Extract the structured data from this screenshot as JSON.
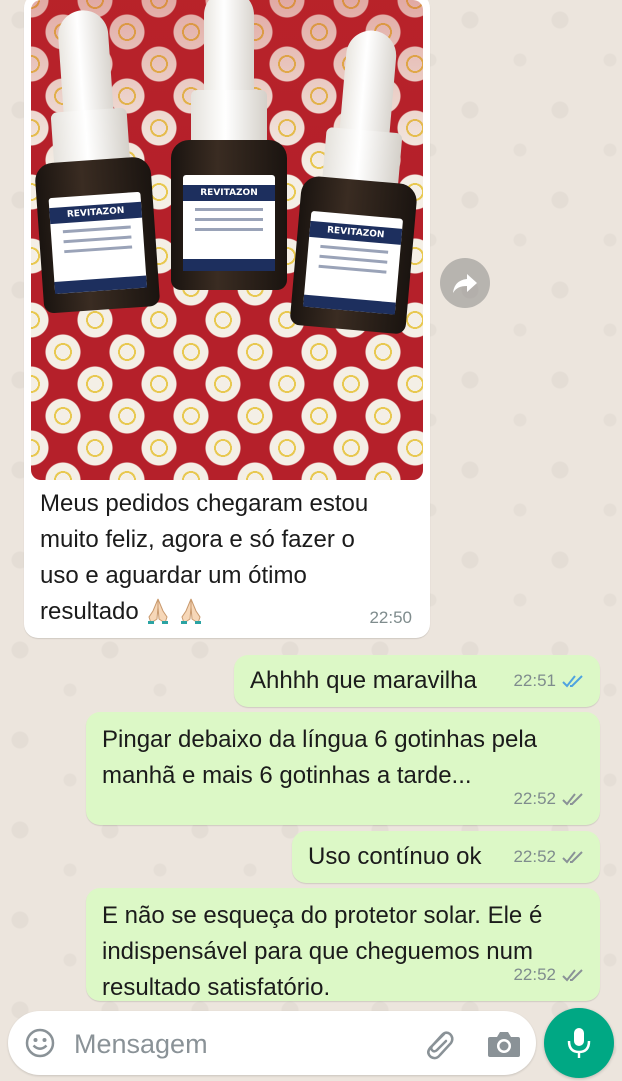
{
  "chat": {
    "incoming": {
      "photo_alt": "",
      "bottle_label": "REVITAZON",
      "text": "Meus pedidos chegaram estou muito feliz, agora e só fazer o uso e aguardar um ótimo resultado",
      "line1": "Meus pedidos chegaram estou",
      "line2": "muito feliz, agora e só fazer o",
      "line3": "uso e aguardar um ótimo",
      "line4": "resultado",
      "emoji": "folded-hands-emoji x2",
      "time": "22:50"
    },
    "outgoing": [
      {
        "line1": "Ahhhh que maravilha",
        "time": "22:51",
        "status": "read"
      },
      {
        "line1": "Pingar debaixo da língua 6 gotinhas pela",
        "line2": "manhã e mais 6 gotinhas a tarde...",
        "time": "22:52",
        "status": "delivered"
      },
      {
        "line1": "Uso contínuo ok",
        "time": "22:52",
        "status": "delivered"
      },
      {
        "line1": "E não se esqueça do protetor solar. Ele é",
        "line2": "indispensável para que cheguemos num",
        "line3": "resultado satisfatório.",
        "time": "22:52",
        "status": "delivered"
      }
    ]
  },
  "input_bar": {
    "placeholder": "Mensagem",
    "icons": [
      "emoji-icon",
      "paperclip-icon",
      "camera-icon",
      "microphone-icon"
    ]
  },
  "colors": {
    "outgoing_bubble": "#dcf8c6",
    "incoming_bubble": "#ffffff",
    "read_tick": "#4fa3e0",
    "delivered_tick": "#8a9297",
    "mic_button": "#00a884"
  }
}
